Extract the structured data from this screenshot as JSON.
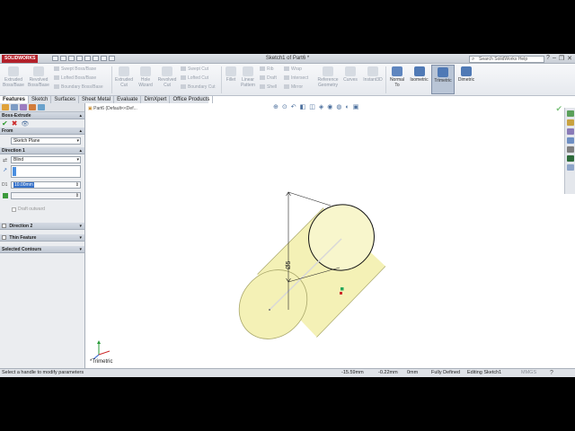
{
  "app": {
    "logo": "SOLIDWORKS",
    "title": "Sketch1 of Part6 *",
    "search_placeholder": "Search SolidWorks Help",
    "window_controls": [
      "?",
      "–",
      "❐",
      "✕"
    ]
  },
  "ribbon": {
    "extruded_boss": "Extruded Boss/Base",
    "revolved_boss": "Revolved Boss/Base",
    "swept_boss": "Swept Boss/Base",
    "lofted_boss": "Lofted Boss/Base",
    "boundary_boss": "Boundary Boss/Base",
    "extruded_cut": "Extruded Cut",
    "hole_wizard": "Hole Wizard",
    "revolved_cut": "Revolved Cut",
    "swept_cut": "Swept Cut",
    "lofted_cut": "Lofted Cut",
    "boundary_cut": "Boundary Cut",
    "fillet": "Fillet",
    "linear_pattern": "Linear Pattern",
    "rib": "Rib",
    "draft": "Draft",
    "shell": "Shell",
    "wrap": "Wrap",
    "intersect": "Intersect",
    "mirror": "Mirror",
    "reference_geometry": "Reference Geometry",
    "curves": "Curves",
    "instant3d": "Instant3D",
    "normal_to": "Normal To",
    "isometric": "Isometric",
    "trimetric": "Trimetric",
    "dimetric": "Dimetric"
  },
  "tabs": [
    "Features",
    "Sketch",
    "Surfaces",
    "Sheet Metal",
    "Evaluate",
    "DimXpert",
    "Office Products"
  ],
  "active_tab": "Features",
  "panel": {
    "feature_title": "Boss-Extrude",
    "from_label": "From",
    "from_value": "Sketch Plane",
    "direction1_label": "Direction 1",
    "end_condition": "Blind",
    "depth_value": "10.00mm",
    "draft_outward": "Draft outward",
    "direction2_label": "Direction 2",
    "thin_feature_label": "Thin Feature",
    "selected_contours_label": "Selected Contours"
  },
  "viewport": {
    "tree_label": "Part6  (Default<<Def...",
    "view_label": "*Trimetric",
    "dimension_text": "Ø5",
    "colors": {
      "body_fill": "#f4f1b6",
      "body_edge": "#a9a76a",
      "highlight": "#d9d8d8"
    }
  },
  "status": {
    "message": "Select a handle to modify parameters",
    "x": "-15.59mm",
    "y": "-0.22mm",
    "z": "0mm",
    "state": "Fully Defined",
    "editing": "Editing Sketch1",
    "units": "MMGS"
  }
}
